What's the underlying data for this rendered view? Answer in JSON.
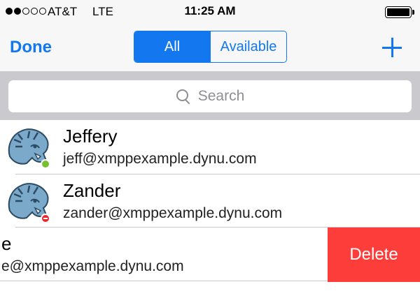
{
  "status_bar": {
    "carrier": "AT&T",
    "network": "LTE",
    "time": "11:25 AM",
    "signal_bars_filled": 2,
    "signal_bars_total": 5
  },
  "nav": {
    "done_label": "Done",
    "segments": [
      {
        "label": "All",
        "selected": true
      },
      {
        "label": "Available",
        "selected": false
      }
    ],
    "add_icon": "plus-icon"
  },
  "search": {
    "placeholder": "Search",
    "icon": "search-icon"
  },
  "contacts": [
    {
      "name": "Jeffery",
      "jid": "jeff@xmppexample.dynu.com",
      "status": "online",
      "status_color": "#76c031"
    },
    {
      "name": "Zander",
      "jid": "zander@xmppexample.dynu.com",
      "status": "busy",
      "status_color": "#e8282b"
    },
    {
      "name": "e",
      "jid": "e@xmppexample.dynu.com",
      "swiped": true
    }
  ],
  "swipe_action": {
    "label": "Delete",
    "color": "#fc3d39"
  },
  "colors": {
    "accent": "#1378f0",
    "search_bar_bg": "#c9c9ce",
    "nav_bg": "#f7f7f7"
  }
}
